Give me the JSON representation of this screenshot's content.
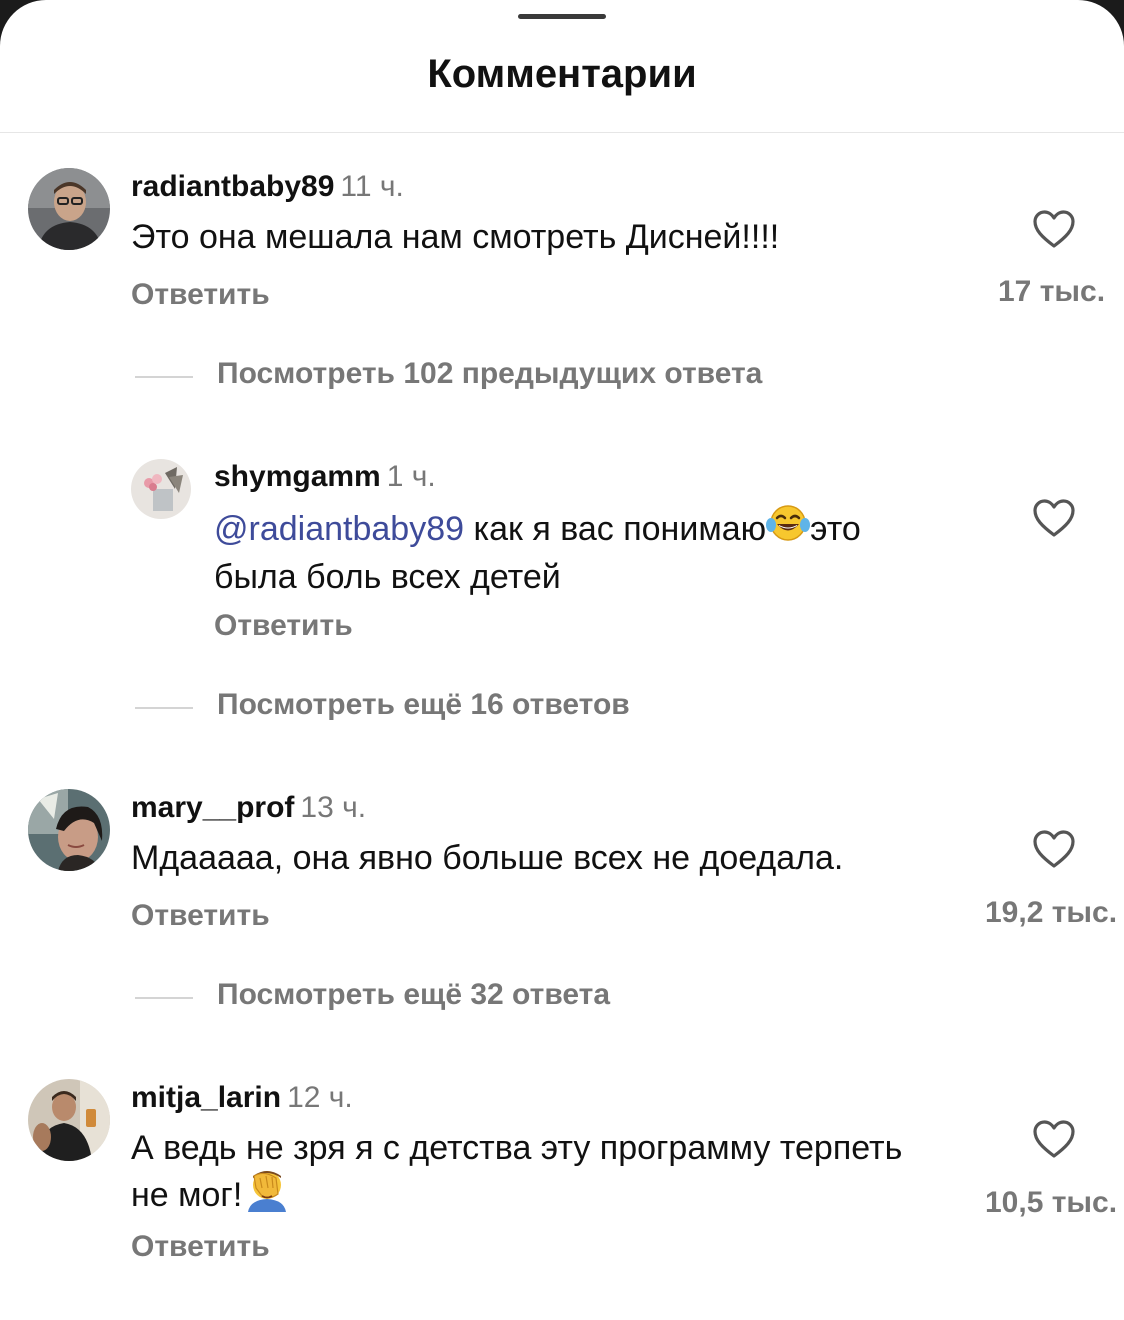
{
  "sheet": {
    "title": "Комментарии"
  },
  "comments": [
    {
      "username": "radiantbaby89",
      "time": "11 ч.",
      "text": "Это она мешала нам смотреть Дисней!!!!",
      "reply_label": "Ответить",
      "likes": "17 тыс.",
      "avatar_icon": "man-with-glasses-photo"
    },
    {
      "username": "shymgamm",
      "time": "1 ч.",
      "mention": "@radiantbaby89",
      "text_line1": "как я вас понимаю",
      "text_after_emoji": "это",
      "text_line2": "была боль всех детей",
      "emoji": "tears-of-joy-emoji",
      "reply_label": "Ответить",
      "avatar_icon": "flowers-photo"
    },
    {
      "username": "mary__prof",
      "time": "13 ч.",
      "text": "Мдааааа, она явно больше всех не доедала.",
      "reply_label": "Ответить",
      "likes": "19,2 тыс.",
      "avatar_icon": "woman-photo"
    },
    {
      "username": "mitja_larin",
      "time": "12 ч.",
      "text_line1": "А ведь не зря я с детства эту программу терпеть",
      "text_line2": "не мог!",
      "emoji": "facepalm-emoji",
      "reply_label": "Ответить",
      "likes": "10,5 тыс.",
      "avatar_icon": "man-mirror-selfie-photo"
    }
  ],
  "view_more": [
    "Посмотреть 102 предыдущих ответа",
    "Посмотреть ещё 16 ответов",
    "Посмотреть ещё 32 ответа"
  ],
  "colors": {
    "background": "#ffffff",
    "text": "#111111",
    "secondary": "#777777",
    "mention": "#3e4b9a"
  }
}
